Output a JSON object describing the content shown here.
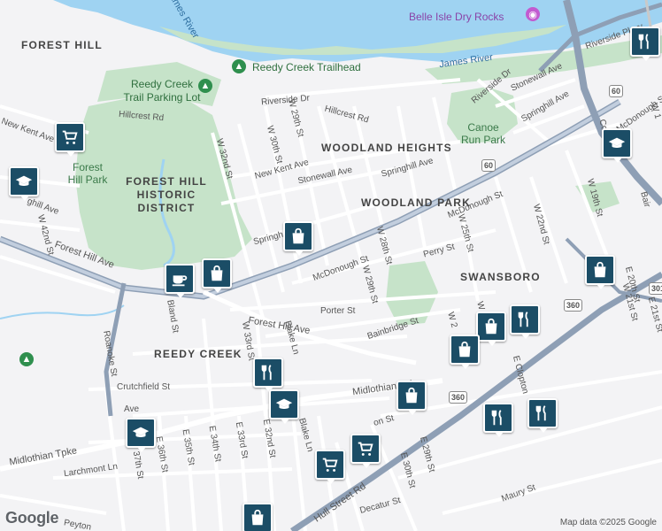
{
  "map": {
    "water": [
      "James River",
      "James River"
    ],
    "pois": {
      "belle_isle": "Belle Isle Dry Rocks",
      "trailhead": "Reedy Creek Trailhead",
      "trail_parking": "Reedy Creek Trail Parking Lot",
      "forest_hill_park": "Forest Hill Park",
      "historic_district": "FOREST HILL HISTORIC DISTRICT",
      "canoe_run": "Canoe Run Park"
    },
    "areas": {
      "forest_hill": "FOREST HILL",
      "woodland_heights": "WOODLAND HEIGHTS",
      "woodland_park": "WOODLAND PARK",
      "swansboro": "SWANSBORO",
      "reedy_creek": "REEDY CREEK"
    },
    "streets": {
      "riverside_dr_1": "Riverside Dr",
      "riverside_dr_2": "Riverside Dr",
      "riverside_dr_3": "Riverside Dr",
      "hillcrest_1": "Hillcrest Rd",
      "hillcrest_2": "Hillcrest Rd",
      "new_kent_1": "New Kent Ave",
      "new_kent_2": "New Kent Ave",
      "stonewall_1": "Stonewall Ave",
      "stonewall_2": "Stonewall Ave",
      "springhill_1": "Springhill Ave",
      "springhill_2": "Springhill Ave",
      "springhill_3": "Springhill Ave",
      "springhill_4": "Springh",
      "w29_1": "W 29th St",
      "w30": "W 30th St",
      "w32": "W 32nd St",
      "w28": "W 28th St",
      "w29_2": "W 29th St",
      "w25": "W 25th St",
      "w22": "W 22nd St",
      "w19": "W 19th St",
      "w21": "W 21st St",
      "w42": "W 42nd St",
      "mcdonough_1": "McDonough St",
      "mcdonough_2": "McDonough St",
      "mcdonough_3": "McDonough St",
      "perry": "Perry St",
      "porter": "Porter St",
      "bainbridge": "Bainbridge St",
      "forest_hill_ave_1": "Forest Hill Ave",
      "forest_hill_ave_2": "Forest Hill Ave",
      "roanoke": "Roanoke St",
      "bland": "Bland St",
      "crutchfield": "Crutchfield St",
      "midlothian_1": "Midlothian Tpke",
      "midlothian_2": "Midlothian Tpke",
      "blake": "Blake Ln",
      "blake_2": "Blake Ln",
      "w33": "W 33rd St",
      "e32": "E 32nd St",
      "e33": "E 33rd St",
      "e34": "E 34th St",
      "e35": "E 35th St",
      "e36": "E 36th St",
      "e37": "37th St",
      "larchmont": "Larchmont Ln",
      "peyton": "Peyton",
      "hull": "Hull Street Rd",
      "e30": "E 30th St",
      "e29": "E 29th St",
      "decatur": "Decatur St",
      "maury": "Maury St",
      "e20": "E 20th St",
      "e21": "E 21st St",
      "e_clopton": "E Clopton",
      "cowardin": "Cowardin",
      "rive_pkwy": "Riverside Pkwy",
      "on_st": "on St",
      "ave_frag": "Ave",
      "w2_frag": "W 2",
      "w_frag": "W",
      "w1_frag": "W 1",
      "ghill": "ghill Ave",
      "bair": "Bair"
    },
    "routes": [
      "60",
      "60",
      "360",
      "360",
      "301"
    ],
    "icons": [
      "shopping-bag-icon",
      "cafe-icon",
      "school-icon",
      "restaurant-icon",
      "grocery-cart-icon",
      "park-tree-icon",
      "camera-icon"
    ],
    "colors": {
      "river": "#9fd3f2",
      "park": "#c6e3c9",
      "highway": "#8e9fb5",
      "road": "#ffffff",
      "pin": "#1b4d66"
    }
  },
  "footer": {
    "logo": "Google",
    "attribution": "Map data ©2025 Google"
  }
}
